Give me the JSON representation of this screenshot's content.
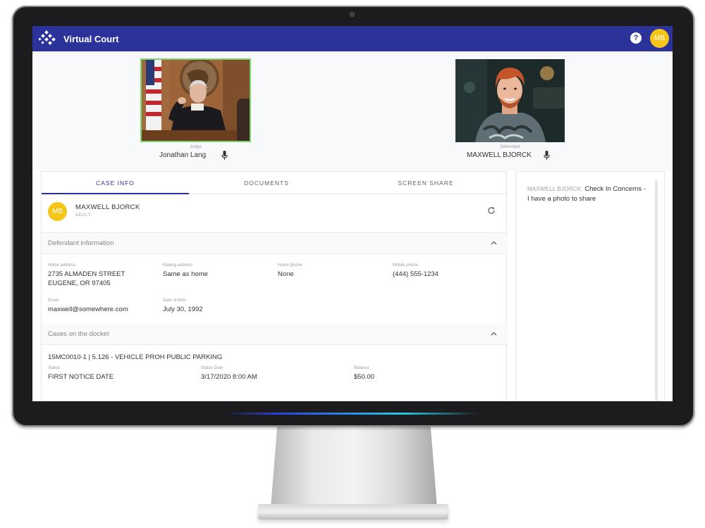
{
  "app": {
    "title": "Virtual Court",
    "help_glyph": "?",
    "user_initials": "MB"
  },
  "participants": {
    "judge": {
      "role": "Judge",
      "name": "Jonathan Lang"
    },
    "defendant": {
      "role": "Defendant",
      "name": "MAXWELL BJORCK"
    }
  },
  "tabs": [
    {
      "label": "CASE INFO",
      "active": true
    },
    {
      "label": "DOCUMENTS",
      "active": false
    },
    {
      "label": "SCREEN SHARE",
      "active": false
    }
  ],
  "person": {
    "initials": "MB",
    "name": "MAXWELL BJORCK",
    "tag": "ADULT"
  },
  "defendant_info": {
    "title": "Defendant information",
    "home_address": {
      "label": "Home address",
      "line1": "2735 ALMADEN STREET",
      "line2": "EUGENE, OR 97405"
    },
    "mailing_address": {
      "label": "Mailing address",
      "value": "Same as home"
    },
    "home_phone": {
      "label": "Home phone",
      "value": "None"
    },
    "mobile_phone": {
      "label": "Mobile phone",
      "value": "(444) 555-1234"
    },
    "email": {
      "label": "Email",
      "value": "maxwell@somewhere.com"
    },
    "dob": {
      "label": "Date of birth",
      "value": "July 30, 1992"
    }
  },
  "docket": {
    "title": "Cases on the docket",
    "case_title": "15MC0010-1 | 5.126 - VEHICLE PROH PUBLIC PARKING",
    "status": {
      "label": "Status",
      "value": "FIRST NOTICE DATE"
    },
    "status_date": {
      "label": "Status Date",
      "value": "3/17/2020 8:00 AM"
    },
    "balance": {
      "label": "Balance",
      "value": "$50.00"
    }
  },
  "chat": {
    "sender": "MAXWELL BJORCK:",
    "message": "Check In Concerns - I have a photo to share"
  },
  "colors": {
    "appbar": "#2b339b",
    "avatar": "#f5c518",
    "active_tab": "#2b339b",
    "judge_frame": "#7ad36c"
  }
}
